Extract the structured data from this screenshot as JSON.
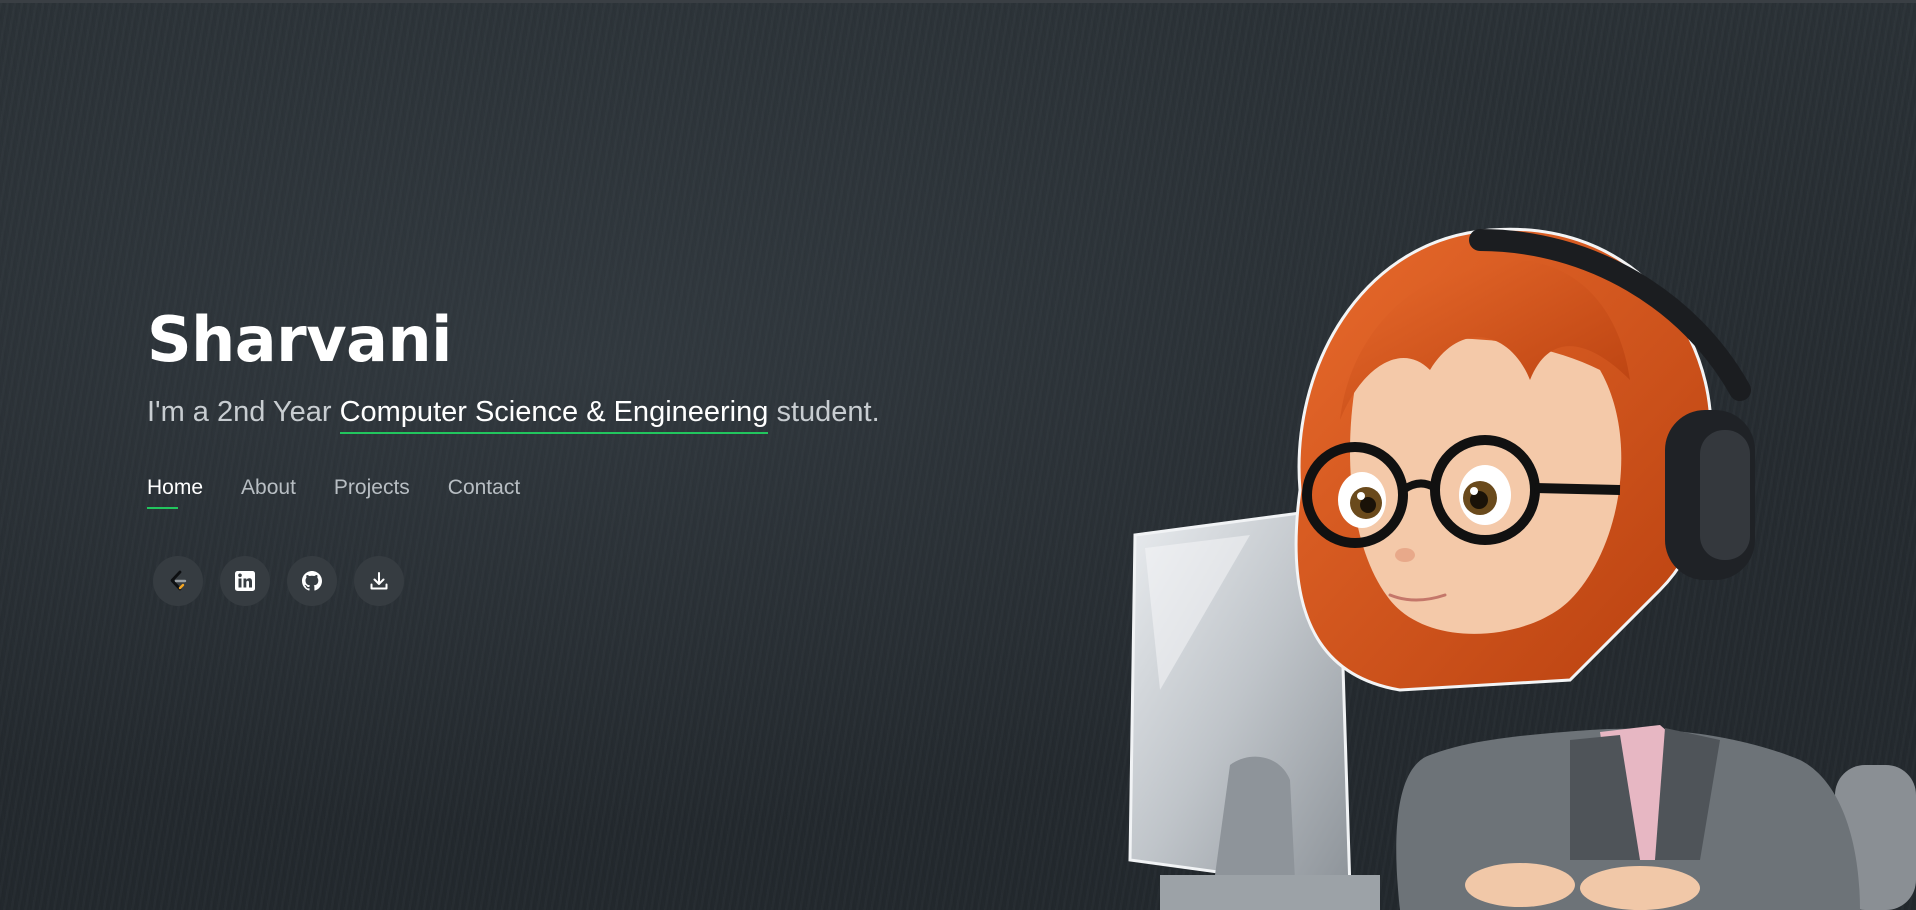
{
  "hero": {
    "name": "Sharvani",
    "tagline_pre": "I'm a 2nd Year ",
    "tagline_highlight": "Computer Science & Engineering",
    "tagline_post": " student."
  },
  "nav": {
    "items": [
      {
        "label": "Home",
        "active": true
      },
      {
        "label": "About",
        "active": false
      },
      {
        "label": "Projects",
        "active": false
      },
      {
        "label": "Contact",
        "active": false
      }
    ]
  },
  "socials": [
    {
      "icon": "leetcode-icon"
    },
    {
      "icon": "linkedin-icon"
    },
    {
      "icon": "github-icon"
    },
    {
      "icon": "download-icon"
    }
  ],
  "colors": {
    "accent": "#22c55e",
    "background": "#262c31",
    "hair": "#d9541e"
  }
}
